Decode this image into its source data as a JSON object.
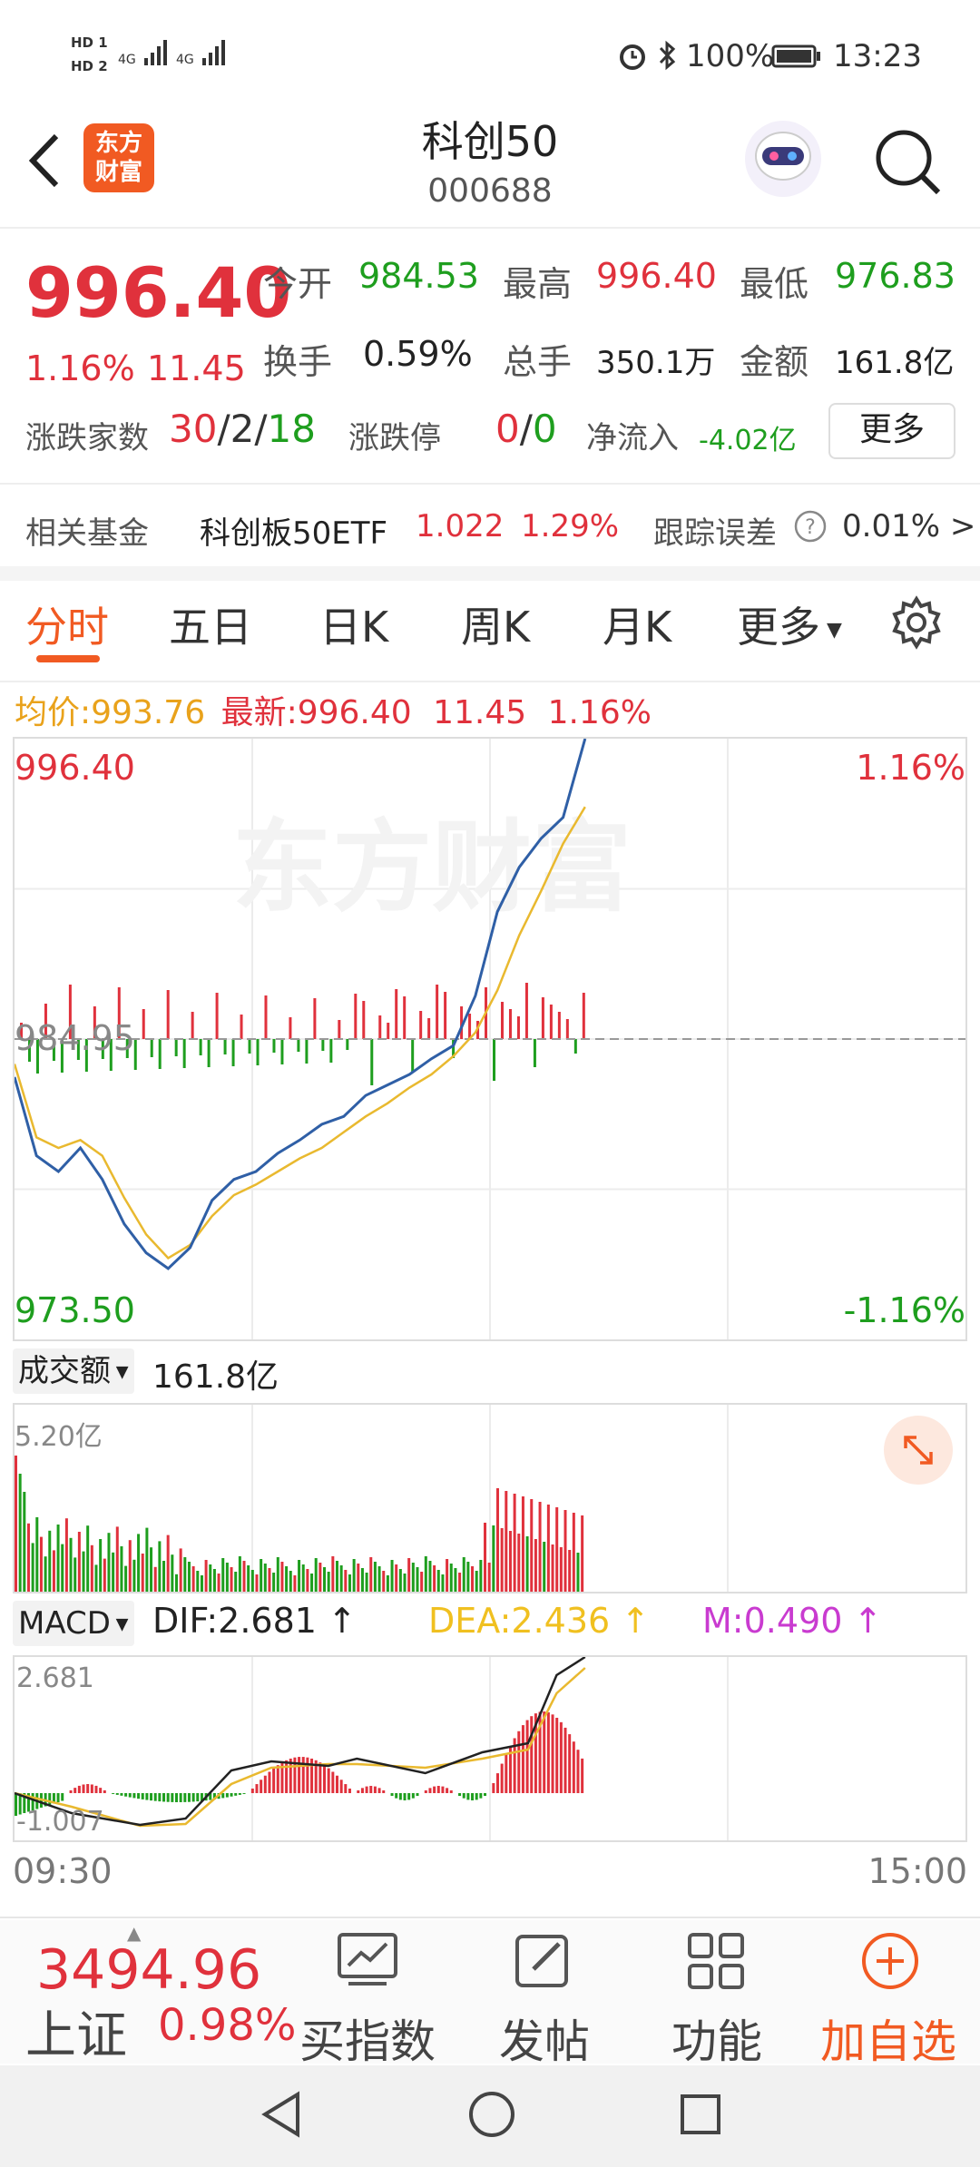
{
  "status_bar": {
    "hd1": "HD 1",
    "hd2": "HD 2",
    "net1": "4G",
    "net2": "4G",
    "battery": "100%",
    "time": "13:23"
  },
  "header": {
    "title": "科创50",
    "code": "000688",
    "logo_line1": "东方",
    "logo_line2": "财富"
  },
  "quote": {
    "price": "996.40",
    "change_pct": "1.16%",
    "change": "11.45",
    "open_label": "今开",
    "open": "984.53",
    "high_label": "最高",
    "high": "996.40",
    "low_label": "最低",
    "low": "976.83",
    "turnover_label": "换手",
    "turnover": "0.59%",
    "volume_label": "总手",
    "volume": "350.1万",
    "amount_label": "金额",
    "amount": "161.8亿",
    "breadth_label": "涨跌家数",
    "breadth_up": "30",
    "breadth_flat": "2",
    "breadth_down": "18",
    "limit_label": "涨跌停",
    "limit_up": "0",
    "limit_down": "0",
    "netflow_label": "净流入",
    "netflow": "-4.02亿",
    "more_button": "更多"
  },
  "fund": {
    "label": "相关基金",
    "name": "科创板50ETF",
    "price": "1.022",
    "pct": "1.29%",
    "tracking_label": "跟踪误差",
    "tracking_value": "0.01% >"
  },
  "tabs": [
    "分时",
    "五日",
    "日K",
    "周K",
    "月K",
    "更多"
  ],
  "info_line": {
    "avg_label": "均价:",
    "avg": "993.76",
    "latest_label": "最新:",
    "latest": "996.40",
    "change": "11.45",
    "pct": "1.16%"
  },
  "watermark": "东方财富",
  "main_chart": {
    "top_left": "996.40",
    "top_right": "1.16%",
    "mid_left": "984.95",
    "bottom_left": "973.50",
    "bottom_right": "-1.16%"
  },
  "volume_panel": {
    "selector": "成交额",
    "value": "161.8亿",
    "max_label": "5.20亿"
  },
  "macd_panel": {
    "selector": "MACD",
    "dif": "DIF:2.681",
    "dea": "DEA:2.436",
    "m": "M:0.490",
    "top_label": "2.681",
    "bottom_label": "-1.007"
  },
  "time_axis": {
    "start": "09:30",
    "end": "15:00"
  },
  "bottom_bar": {
    "index_value": "3494.96",
    "index_name": "上证",
    "index_pct": "0.98%",
    "buy_index": "买指数",
    "post": "发帖",
    "functions": "功能",
    "add_watch": "加自选"
  },
  "colors": {
    "up": "#e0313c",
    "down": "#1e9e1e",
    "price_line": "#2f5fa6",
    "avg_line": "#e9b92f",
    "accent": "#f15a22"
  },
  "chart_data": {
    "type": "line",
    "title": "",
    "ylim": [
      973.5,
      996.4
    ],
    "prev_close": 984.95,
    "x": [
      "09:30",
      "15:00"
    ],
    "series": [
      {
        "values": [
          983.5,
          980.5,
          979.9,
          980.8,
          979.6,
          977.9,
          976.8,
          976.2,
          977.0,
          978.8,
          979.6,
          979.9,
          980.6,
          981.1,
          981.7,
          982.0,
          982.8,
          983.2,
          983.6,
          984.2,
          984.7,
          986.6,
          989.8,
          991.5,
          992.6,
          993.4,
          996.4
        ]
      },
      {
        "values": [
          984.0,
          981.2,
          980.8,
          981.1,
          980.5,
          978.9,
          977.5,
          976.6,
          977.1,
          978.2,
          979.0,
          979.4,
          979.9,
          980.4,
          980.8,
          981.4,
          982.0,
          982.5,
          983.1,
          983.6,
          984.3,
          985.2,
          986.8,
          988.9,
          990.6,
          992.4,
          993.8
        ]
      }
    ]
  }
}
